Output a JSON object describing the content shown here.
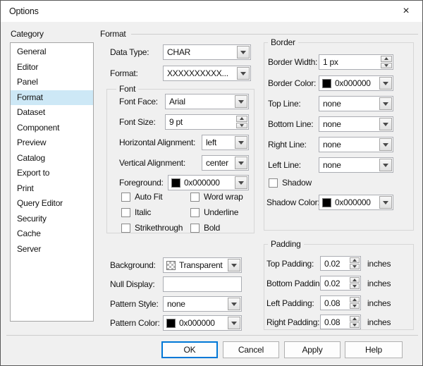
{
  "window": {
    "title": "Options",
    "close_glyph": "×"
  },
  "sidebar": {
    "label": "Category",
    "selected_item": "Format",
    "items": [
      {
        "label": "General"
      },
      {
        "label": "Editor"
      },
      {
        "label": "Panel"
      },
      {
        "label": "Format"
      },
      {
        "label": "Dataset"
      },
      {
        "label": "Component"
      },
      {
        "label": "Preview"
      },
      {
        "label": "Catalog"
      },
      {
        "label": "Export to"
      },
      {
        "label": "Print"
      },
      {
        "label": "Query Editor"
      },
      {
        "label": "Security"
      },
      {
        "label": "Cache"
      },
      {
        "label": "Server"
      }
    ]
  },
  "section": {
    "title": "Format"
  },
  "format_panel": {
    "data_type": {
      "label": "Data Type:",
      "value": "CHAR"
    },
    "format": {
      "label": "Format:",
      "value": "XXXXXXXXXX..."
    },
    "font": {
      "title": "Font",
      "font_face": {
        "label": "Font Face:",
        "value": "Arial"
      },
      "font_size": {
        "label": "Font Size:",
        "value": "9 pt"
      },
      "horizontal_alignment": {
        "label": "Horizontal Alignment:",
        "value": "left"
      },
      "vertical_alignment": {
        "label": "Vertical Alignment:",
        "value": "center"
      },
      "foreground": {
        "label": "Foreground:",
        "value": "0x000000",
        "swatch_color": "#000000"
      },
      "checkboxes": [
        {
          "label": "Auto Fit",
          "checked": false
        },
        {
          "label": "Word wrap",
          "checked": false
        },
        {
          "label": "Italic",
          "checked": false
        },
        {
          "label": "Underline",
          "checked": false
        },
        {
          "label": "Strikethrough",
          "checked": false
        },
        {
          "label": "Bold",
          "checked": false
        }
      ]
    },
    "background": {
      "label": "Background:",
      "value": "Transparent",
      "swatch": "transparent-checker"
    },
    "null_display": {
      "label": "Null Display:",
      "value": ""
    },
    "pattern_style": {
      "label": "Pattern Style:",
      "value": "none"
    },
    "pattern_color": {
      "label": "Pattern Color:",
      "value": "0x000000",
      "swatch_color": "#000000"
    }
  },
  "border_panel": {
    "title": "Border",
    "border_width": {
      "label": "Border Width:",
      "value": "1 px"
    },
    "border_color": {
      "label": "Border Color:",
      "value": "0x000000",
      "swatch_color": "#000000"
    },
    "top_line": {
      "label": "Top Line:",
      "value": "none"
    },
    "bottom_line": {
      "label": "Bottom Line:",
      "value": "none"
    },
    "right_line": {
      "label": "Right Line:",
      "value": "none"
    },
    "left_line": {
      "label": "Left Line:",
      "value": "none"
    },
    "shadow": {
      "label": "Shadow",
      "checked": false
    },
    "shadow_color": {
      "label": "Shadow Color:",
      "value": "0x000000",
      "swatch_color": "#000000"
    }
  },
  "padding_panel": {
    "title": "Padding",
    "rows": [
      {
        "label": "Top Padding:",
        "value": "0.02",
        "unit": "inches"
      },
      {
        "label": "Bottom Padding:",
        "value": "0.02",
        "unit": "inches"
      },
      {
        "label": "Left Padding:",
        "value": "0.08",
        "unit": "inches"
      },
      {
        "label": "Right Padding:",
        "value": "0.08",
        "unit": "inches"
      }
    ]
  },
  "footer": {
    "buttons": [
      {
        "label": "OK"
      },
      {
        "label": "Cancel"
      },
      {
        "label": "Apply"
      },
      {
        "label": "Help"
      }
    ]
  },
  "colors": {
    "selection_bg": "#cde8f6",
    "accent": "#0078d7",
    "window_bg": "#f0f0f0",
    "titlebar_bg": "#ffffff",
    "swatch_black": "#000000"
  }
}
